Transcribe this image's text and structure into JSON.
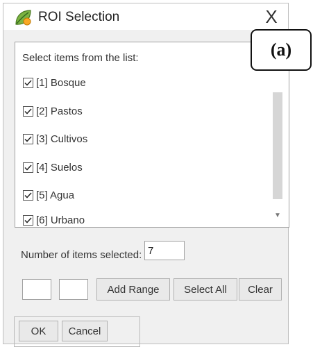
{
  "window": {
    "title": "ROI Selection",
    "close_label": "X"
  },
  "list": {
    "heading": "Select items from the list:",
    "items": [
      {
        "label": "[1] Bosque",
        "checked": true
      },
      {
        "label": "[2] Pastos",
        "checked": true
      },
      {
        "label": "[3] Cultivos",
        "checked": true
      },
      {
        "label": "[4] Suelos",
        "checked": true
      },
      {
        "label": "[5] Agua",
        "checked": true
      },
      {
        "label": "[6] Urbano",
        "checked": true
      }
    ]
  },
  "count": {
    "label": "Number of items selected:",
    "value": "7"
  },
  "range": {
    "from_value": "",
    "to_value": ""
  },
  "buttons": {
    "add_range": "Add Range",
    "select_all": "Select All",
    "clear": "Clear",
    "ok": "OK",
    "cancel": "Cancel"
  },
  "annotation": {
    "label": "(a)"
  },
  "colors": {
    "app_icon_leaf": "#7cb342",
    "app_icon_accent": "#f9a825"
  }
}
